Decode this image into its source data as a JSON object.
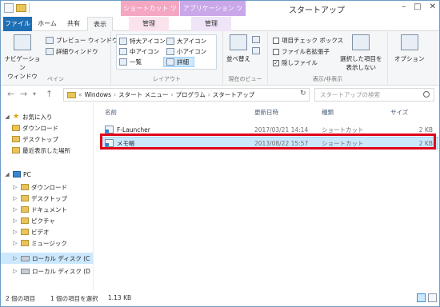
{
  "window": {
    "title": "スタートアップ",
    "context_tabs": {
      "shortcut_tools": "ショートカット ツール",
      "app_tools": "アプリケーション ツール"
    }
  },
  "tabs": {
    "file": "ファイル",
    "home": "ホーム",
    "share": "共有",
    "view": "表示",
    "manage_shortcut": "管理",
    "manage_app": "管理"
  },
  "ribbon": {
    "pane": {
      "nav_pane": "ナビゲーション\nウィンドウ",
      "preview": "プレビュー ウィンドウ",
      "details": "詳細ウィンドウ",
      "label": "ペイン"
    },
    "layout": {
      "xl_icons": "特大アイコン",
      "large_icons": "大アイコン",
      "medium_icons": "中アイコン",
      "small_icons": "小アイコン",
      "list": "一覧",
      "details": "詳細",
      "label": "レイアウト"
    },
    "current_view": {
      "sort": "並べ替え",
      "label": "現在のビュー"
    },
    "show_hide": {
      "item_checkboxes": "項目チェック ボックス",
      "file_ext": "ファイル名拡張子",
      "hidden_items": "隠しファイル",
      "hide_selected": "選択した項目を\n表示しない",
      "label": "表示/非表示"
    },
    "options": "オプション"
  },
  "address": {
    "breadcrumb": [
      "Windows",
      "スタート メニュー",
      "プログラム",
      "スタートアップ"
    ],
    "search_placeholder": "スタートアップの検索"
  },
  "nav": {
    "items": [
      {
        "label": "お気に入り",
        "icon": "star-icon"
      },
      {
        "label": "ダウンロード",
        "icon": "folder-icon"
      },
      {
        "label": "デスクトップ",
        "icon": "folder-icon"
      },
      {
        "label": "最近表示した場所",
        "icon": "folder-icon"
      },
      {
        "label": "PC",
        "icon": "pc-icon"
      },
      {
        "label": "ダウンロード",
        "icon": "folder-icon"
      },
      {
        "label": "デスクトップ",
        "icon": "folder-icon"
      },
      {
        "label": "ドキュメント",
        "icon": "folder-icon"
      },
      {
        "label": "ピクチャ",
        "icon": "folder-icon"
      },
      {
        "label": "ビデオ",
        "icon": "folder-icon"
      },
      {
        "label": "ミュージック",
        "icon": "folder-icon"
      },
      {
        "label": "ローカル ディスク (C",
        "icon": "drive-icon"
      },
      {
        "label": "ローカル ディスク (D",
        "icon": "drive-icon"
      }
    ]
  },
  "files": {
    "columns": {
      "name": "名前",
      "modified": "更新日時",
      "type": "種類",
      "size": "サイズ"
    },
    "rows": [
      {
        "name": "F-Launcher",
        "modified": "2017/03/21 14:14",
        "type": "ショートカット",
        "size": "2 KB"
      },
      {
        "name": "メモ帳",
        "modified": "2013/08/22 15:57",
        "type": "ショートカット",
        "size": "2 KB"
      }
    ]
  },
  "status": {
    "count": "2 個の項目",
    "selection": "1 個の項目を選択",
    "size": "1.13 KB"
  }
}
